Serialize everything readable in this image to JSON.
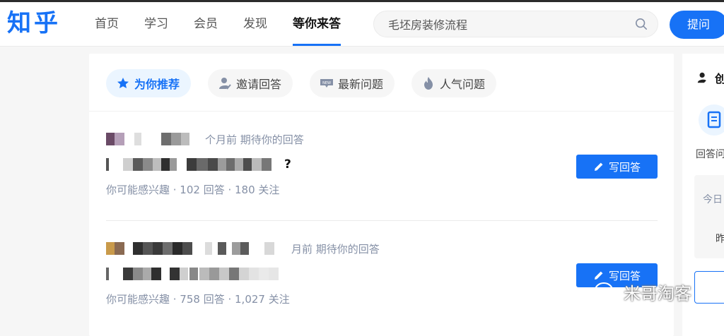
{
  "logo": "知乎",
  "nav": [
    "首页",
    "学习",
    "会员",
    "发现",
    "等你来答"
  ],
  "nav_active_index": 4,
  "search": {
    "placeholder": "毛坯房装修流程",
    "icon": "search-icon"
  },
  "ask_button": "提问",
  "tabs": [
    {
      "label": "为你推荐",
      "icon": "star-icon",
      "active": true
    },
    {
      "label": "邀请回答",
      "icon": "person-pen-icon",
      "active": false
    },
    {
      "label": "最新问题",
      "icon": "new-badge-icon",
      "active": false
    },
    {
      "label": "人气问题",
      "icon": "flame-icon",
      "active": false
    }
  ],
  "questions": [
    {
      "meta": "个月前 期待你的回答",
      "title_suffix": "?",
      "stats": "你可能感兴趣 · 102 回答 · 180 关注",
      "button": "写回答"
    },
    {
      "meta": "月前 期待你的回答",
      "title_suffix": "",
      "stats": "你可能感兴趣 · 758 回答 · 1,027 关注",
      "button": "写回答"
    }
  ],
  "sidebar": {
    "title": "创",
    "label": "回答问",
    "card_line1": "今日",
    "card_line2": "昨"
  },
  "watermark": "米哥淘客",
  "colors": {
    "accent": "#1772f6",
    "muted": "#8590a6",
    "bg": "#f6f6f6"
  }
}
